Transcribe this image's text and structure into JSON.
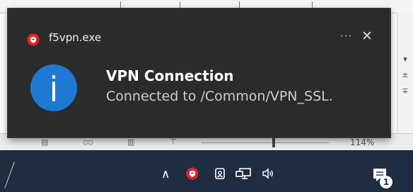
{
  "notification": {
    "app_name": "f5vpn.exe",
    "app_icon": "f5-shield-icon",
    "more_label": "···",
    "close_label": "✕",
    "type_icon": "info-icon",
    "title": "VPN Connection",
    "body": "Connected to /Common/VPN_SSL.",
    "accent_color": "#1f79d3"
  },
  "background_app": {
    "zoom_label": "114%",
    "zoom_slider_value": 0.55
  },
  "taskbar": {
    "show_hidden_label": "∧",
    "tray_icons": [
      "f5-vpn-icon",
      "meet-now-icon",
      "network-icon",
      "volume-icon"
    ],
    "volume_label": "🔈",
    "notification_count": "1",
    "background_color": "#1e2d40"
  }
}
